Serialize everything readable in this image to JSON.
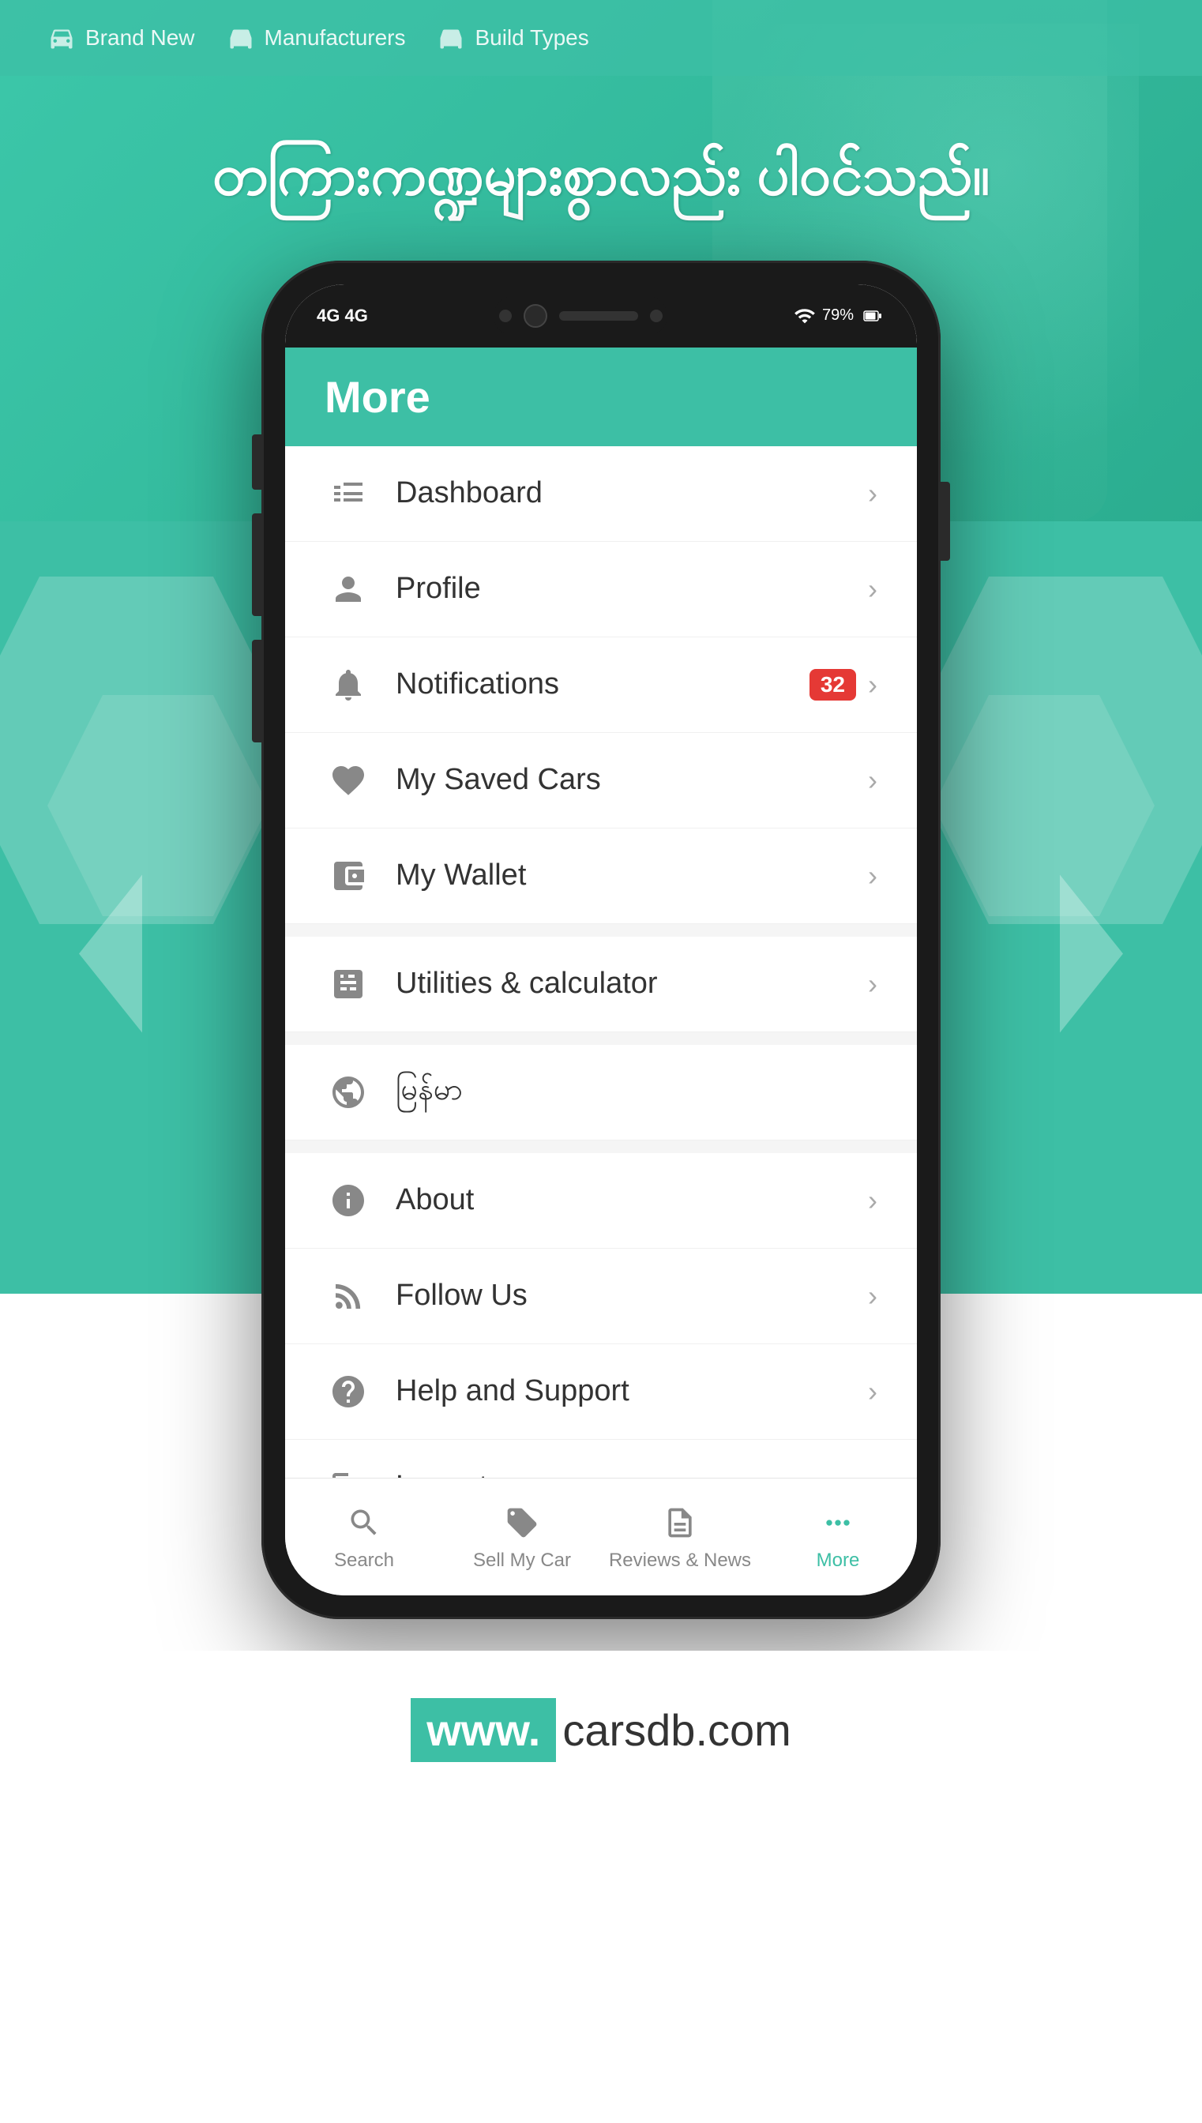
{
  "page": {
    "background_color": "#3dbfa5",
    "accent_color": "#3dbfa5",
    "badge_color": "#e53935"
  },
  "top_nav": {
    "items": [
      {
        "label": "Brand New",
        "icon": "car-icon"
      },
      {
        "label": "Manufacturers",
        "icon": "manufacturers-icon"
      },
      {
        "label": "Build Types",
        "icon": "build-types-icon"
      }
    ]
  },
  "hero_text": "တကြားကဏ္ဍများစွာလည်း ပါဝင်သည်။",
  "phone": {
    "status_bar": {
      "left": "4G  4G",
      "battery": "79%"
    },
    "header": {
      "title": "More"
    },
    "menu_items": [
      {
        "id": "dashboard",
        "label": "Dashboard",
        "icon": "dashboard-icon",
        "badge": null,
        "has_chevron": true
      },
      {
        "id": "profile",
        "label": "Profile",
        "icon": "profile-icon",
        "badge": null,
        "has_chevron": true
      },
      {
        "id": "notifications",
        "label": "Notifications",
        "icon": "bell-icon",
        "badge": "32",
        "has_chevron": true
      },
      {
        "id": "my-saved-cars",
        "label": "My Saved Cars",
        "icon": "heart-icon",
        "badge": null,
        "has_chevron": true
      },
      {
        "id": "my-wallet",
        "label": "My Wallet",
        "icon": "wallet-icon",
        "badge": null,
        "has_chevron": true
      },
      {
        "id": "utilities",
        "label": "Utilities & calculator",
        "icon": "calculator-icon",
        "badge": null,
        "has_chevron": true
      },
      {
        "id": "language",
        "label": "မြန်မာ",
        "icon": "globe-icon",
        "badge": null,
        "has_chevron": false
      },
      {
        "id": "about",
        "label": "About",
        "icon": "info-icon",
        "badge": null,
        "has_chevron": true
      },
      {
        "id": "follow-us",
        "label": "Follow Us",
        "icon": "rss-icon",
        "badge": null,
        "has_chevron": true
      },
      {
        "id": "help-support",
        "label": "Help and Support",
        "icon": "help-icon",
        "badge": null,
        "has_chevron": true
      },
      {
        "id": "logout",
        "label": "Logout",
        "icon": "logout-icon",
        "badge": null,
        "has_chevron": true
      }
    ],
    "bottom_tabs": [
      {
        "id": "search",
        "label": "Search",
        "icon": "search-icon",
        "active": false
      },
      {
        "id": "sell-my-car",
        "label": "Sell My Car",
        "icon": "tag-icon",
        "active": false
      },
      {
        "id": "reviews-news",
        "label": "Reviews & News",
        "icon": "reviews-icon",
        "active": false
      },
      {
        "id": "more",
        "label": "More",
        "icon": "more-icon",
        "active": true
      }
    ]
  },
  "footer": {
    "www_label": "www.",
    "domain": "carsdb.com"
  }
}
